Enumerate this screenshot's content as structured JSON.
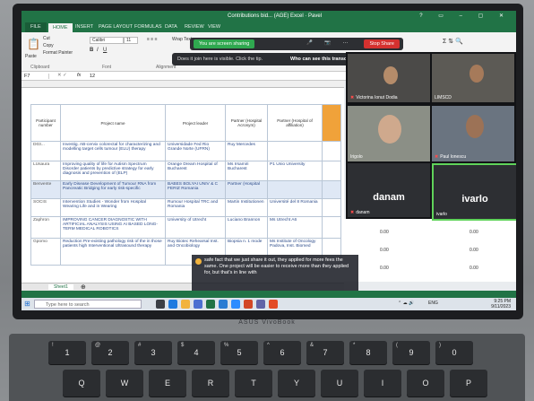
{
  "excel": {
    "title": "Contributions bid... (AGE) Excel · Pavel",
    "tabs": [
      "FILE",
      "HOME",
      "INSERT",
      "PAGE LAYOUT",
      "FORMULAS",
      "DATA",
      "REVIEW",
      "VIEW"
    ],
    "ribbon": {
      "paste": "Paste",
      "cut": "Cut",
      "copy": "Copy",
      "format_painter": "Format Painter",
      "font_name": "Calibri",
      "font_size": "11",
      "wrap": "Wrap Text",
      "groups": [
        "Clipboard",
        "Font",
        "Alignment"
      ]
    },
    "name_box": "F7",
    "fx": "fx",
    "formula_value": "12"
  },
  "sheet": {
    "headers": [
      "Participant number",
      "Project name",
      "Project leader",
      "Partner (Hospital Acronym)",
      "Partner (Hospital of affiliation)"
    ],
    "rows": [
      {
        "id": "D03...",
        "name": "Investig. AB-cervix colorectal for characterizing and modelling target cells tumour (ELU) therapy",
        "leader": "Universidade Fed Rio Grande Norte (UFRN)",
        "p1": "Ruy Mercedes",
        "p2": ""
      },
      {
        "id": "LUsaura",
        "name": "Improving quality of life for Autism Spectrum Disorder patients by predictive strategy for early diagnosis and prevention of (ELP)",
        "leader": "Orange Dream Hospital of Bucharest",
        "p1": "Ms Irsamiri Bucharest",
        "p2": "P1  Unio University"
      },
      {
        "id": "Benvente",
        "name": "Early Disease Development of Tumour RNA from Pancreatic Bridging for early risk-specific",
        "leader": "BABES BOLYAI UNIV & C FERIZ Romania",
        "p1": "Partner (Hospital",
        "p2": ""
      },
      {
        "id": "SOCIS",
        "name": "Intervention Studies - Wonder from Hospital Wearing Life and in Wearing",
        "leader": "Rumour Hospital TRC and Romania",
        "p1": "Martin Institutionen",
        "p2": "Université del 8 Romania"
      },
      {
        "id": "Zaphron",
        "name": "IMPROVING CANCER DIAGNOSTIC WITH ARTIFICIAL ANALYSIS USING AI BASED LONG-TERM MEDICAL ROBOTICS",
        "leader": "University of Utrecht",
        "p1": "Luciano Brannon",
        "p2": "Ms Utrecht A6"
      },
      {
        "id": "Gpomo",
        "name": "Reduction Pre-existing pathology risk of the in those patients high Interventional Ultrasound therapy",
        "leader": "Ruy Biotec Rehearsal Inst. and Oncobiology",
        "p1": "Biopsia n. 1 mode",
        "p2": "Ms Institute of Oncology Padova, Inst. Biomed"
      }
    ],
    "sheet_tab": "Sheet1",
    "right_values": [
      {
        "a": "0.00",
        "b": "0.00"
      },
      {
        "a": "0.00",
        "b": "0.00"
      },
      {
        "a": "0.00",
        "b": "0.00"
      }
    ]
  },
  "meeting": {
    "share_label": "You are screen sharing",
    "stop_label": "Stop Share",
    "tip_text": "Does it join here is visible. Click the tip.",
    "tip_link": "Who can see this transcript?",
    "participants": [
      {
        "name": "Victorina Ionut Dodia"
      },
      {
        "name": "LIMSCD"
      },
      {
        "name": "Irigolo"
      },
      {
        "name": "Paul Ionescu"
      },
      {
        "name": "danam"
      },
      {
        "name": "ivarlo"
      }
    ],
    "caption": "safe fact that we just share it out, they applied for more fees the same. One project will be easier to receive more than they applied for, but that's in line with"
  },
  "taskbar": {
    "search_placeholder": "Type here to search",
    "time": "9:25 PM",
    "date": "9/11/2023",
    "lang": "ENG"
  },
  "laptop": {
    "brand": "ASUS VivoBook",
    "keys_row1": [
      {
        "top": "!",
        "main": "1"
      },
      {
        "top": "@",
        "main": "2"
      },
      {
        "top": "#",
        "main": "3"
      },
      {
        "top": "$",
        "main": "4"
      },
      {
        "top": "%",
        "main": "5"
      },
      {
        "top": "^",
        "main": "6"
      },
      {
        "top": "&",
        "main": "7"
      },
      {
        "top": "*",
        "main": "8"
      },
      {
        "top": "(",
        "main": "9"
      },
      {
        "top": ")",
        "main": "0"
      }
    ],
    "keys_row2": [
      "Q",
      "W",
      "E",
      "R",
      "T",
      "Y",
      "U",
      "I",
      "O",
      "P"
    ]
  },
  "colors": {
    "excel_green": "#217346",
    "share_green": "#2fa84f",
    "stop_red": "#d5312f"
  }
}
